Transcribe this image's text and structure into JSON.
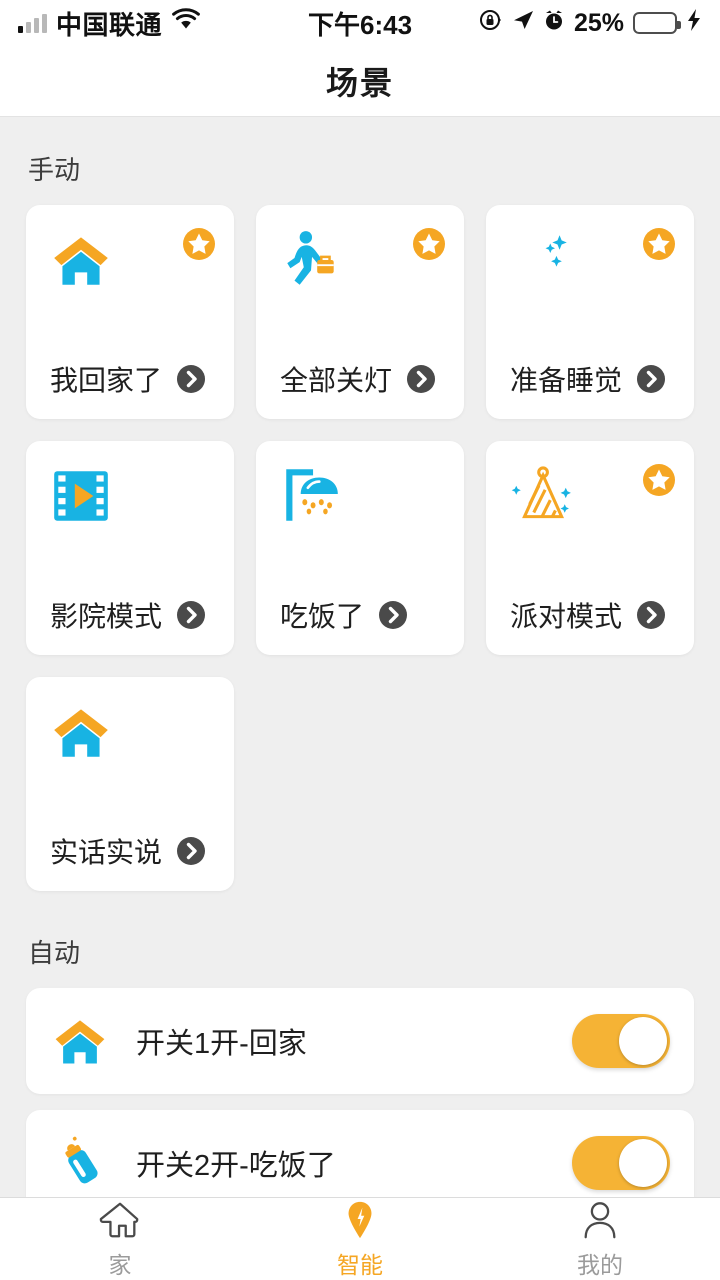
{
  "status_bar": {
    "carrier": "中国联通",
    "signal_bars_active": 1,
    "signal_bars_total": 4,
    "wifi_icon": "wifi-icon",
    "time": "下午6:43",
    "rotation_lock_icon": "rotation-lock-icon",
    "location_icon": "location-arrow-icon",
    "alarm_icon": "alarm-clock-icon",
    "battery_percent": "25%",
    "battery_fill_ratio": 0.25,
    "battery_color": "#ffcc00",
    "charging_icon": "lightning-bolt-icon"
  },
  "navbar": {
    "title": "场景"
  },
  "theme": {
    "accent_orange": "#f5a623",
    "toggle_orange": "#f5b335",
    "icon_cyan": "#18b3e3",
    "icon_orange": "#f5a623",
    "page_background": "#efefef",
    "card_background": "#ffffff",
    "chevron_circle": "#4a4a4a"
  },
  "manual_section": {
    "title": "手动",
    "cards": [
      {
        "label": "我回家了",
        "icon": "home-icon",
        "favorite": true,
        "star_icon": "star-badge-icon",
        "chevron_icon": "chevron-right-icon"
      },
      {
        "label": "全部关灯",
        "icon": "leaving-home-person-icon",
        "favorite": true,
        "star_icon": "star-badge-icon",
        "chevron_icon": "chevron-right-icon"
      },
      {
        "label": "准备睡觉",
        "icon": "moon-stars-icon",
        "favorite": true,
        "star_icon": "star-badge-icon",
        "chevron_icon": "chevron-right-icon"
      },
      {
        "label": "影院模式",
        "icon": "film-play-icon",
        "favorite": false,
        "star_icon": "star-badge-icon",
        "chevron_icon": "chevron-right-icon"
      },
      {
        "label": "吃饭了",
        "icon": "shower-icon",
        "favorite": false,
        "star_icon": "star-badge-icon",
        "chevron_icon": "chevron-right-icon"
      },
      {
        "label": "派对模式",
        "icon": "party-hat-icon",
        "favorite": true,
        "star_icon": "star-badge-icon",
        "chevron_icon": "chevron-right-icon"
      },
      {
        "label": "实话实说",
        "icon": "home-icon",
        "favorite": false,
        "star_icon": "star-badge-icon",
        "chevron_icon": "chevron-right-icon"
      }
    ]
  },
  "auto_section": {
    "title": "自动",
    "rows": [
      {
        "label": "开关1开-回家",
        "icon": "home-icon",
        "toggle_on": true
      },
      {
        "label": "开关2开-吃饭了",
        "icon": "baby-bottle-icon",
        "toggle_on": true
      }
    ]
  },
  "tabbar": {
    "tabs": [
      {
        "label": "家",
        "icon": "home-outline-icon",
        "active": false
      },
      {
        "label": "智能",
        "icon": "smart-pin-icon",
        "active": true
      },
      {
        "label": "我的",
        "icon": "person-outline-icon",
        "active": false
      }
    ]
  }
}
